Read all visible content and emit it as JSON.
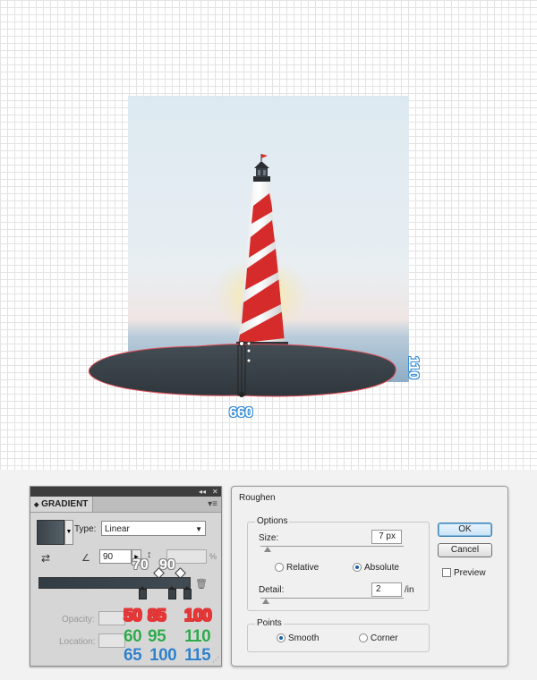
{
  "canvas": {
    "width_label": "660",
    "height_label": "110"
  },
  "gradient_panel": {
    "title": "GRADIENT",
    "type_label": "Type:",
    "type_value": "Linear",
    "angle_value": "90",
    "aspect_unit": "%",
    "stop_location_labels": [
      "70",
      "90"
    ],
    "opacity_label": "Opacity:",
    "location_label": "Location:",
    "stops": [
      {
        "r": "50",
        "g": "60",
        "b": "65"
      },
      {
        "r": "85",
        "g": "95",
        "b": "100"
      },
      {
        "r": "100",
        "g": "110",
        "b": "115"
      }
    ]
  },
  "roughen_dialog": {
    "title": "Roughen",
    "options_legend": "Options",
    "size_label": "Size:",
    "size_value": "7 px",
    "relative_label": "Relative",
    "absolute_label": "Absolute",
    "detail_label": "Detail:",
    "detail_value": "2",
    "detail_unit": "/in",
    "points_legend": "Points",
    "smooth_label": "Smooth",
    "corner_label": "Corner",
    "ok_label": "OK",
    "cancel_label": "Cancel",
    "preview_label": "Preview",
    "selected_mode": "Absolute",
    "selected_points": "Smooth",
    "preview_checked": false
  },
  "colors": {
    "measure_blue": "#3a8fd8",
    "red_label": "#e53a3a",
    "green_label": "#2ea84b",
    "blue_label": "#2f7fc9",
    "ellipse_fill": "#353d44",
    "ellipse_stroke": "#e0505a"
  }
}
